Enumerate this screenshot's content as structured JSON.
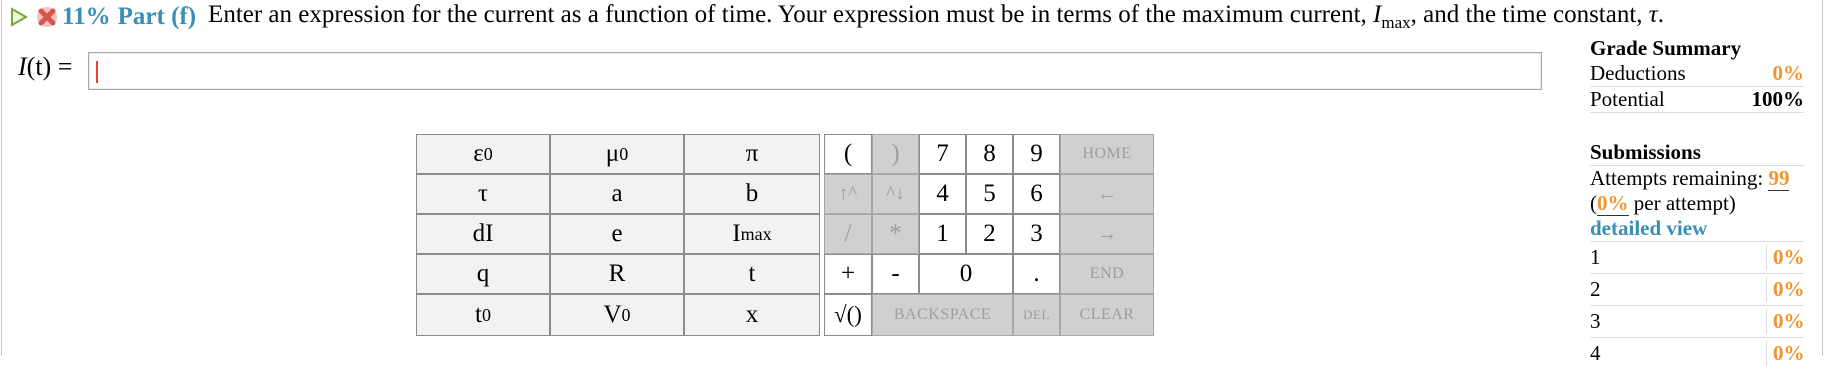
{
  "header": {
    "score_percent": "11%",
    "part_label": "Part (f)",
    "question_text": "Enter an expression for the current as a function of time. Your expression must be in terms of the maximum current, ",
    "var_imax": "I",
    "var_imax_sub": "max",
    "question_mid": ", and the time constant, ",
    "var_tau": "τ",
    "question_end": "."
  },
  "answer": {
    "label_func": "I",
    "label_arg": "(t) =",
    "value": ""
  },
  "keypad": {
    "symbols": [
      {
        "label": "ε",
        "sub": "0"
      },
      {
        "label": "μ",
        "sub": "0"
      },
      {
        "label": "π",
        "sub": ""
      },
      {
        "label": "τ",
        "sub": ""
      },
      {
        "label": "a",
        "sub": ""
      },
      {
        "label": "b",
        "sub": ""
      },
      {
        "label": "dI",
        "sub": ""
      },
      {
        "label": "e",
        "sub": ""
      },
      {
        "label": "I",
        "sub": "max"
      },
      {
        "label": "q",
        "sub": ""
      },
      {
        "label": "R",
        "sub": ""
      },
      {
        "label": "t",
        "sub": ""
      },
      {
        "label": "t",
        "sub": "0"
      },
      {
        "label": "V",
        "sub": "0"
      },
      {
        "label": "x",
        "sub": ""
      }
    ],
    "open_paren": "(",
    "close_paren": ")",
    "up_caret": "↑^",
    "down_caret": "^↓",
    "divide": "/",
    "multiply": "*",
    "plus": "+",
    "minus": "-",
    "sqrt": "√()",
    "digits": [
      "7",
      "8",
      "9",
      "4",
      "5",
      "6",
      "1",
      "2",
      "3",
      "0",
      "."
    ],
    "home": "HOME",
    "left_arrow": "←",
    "right_arrow": "→",
    "end": "END",
    "backspace": "BACKSPACE",
    "del": "DEL",
    "clear": "CLEAR"
  },
  "sidebar": {
    "grade_summary_title": "Grade Summary",
    "deductions_label": "Deductions",
    "deductions_value": "0%",
    "potential_label": "Potential",
    "potential_value": "100%",
    "submissions_title": "Submissions",
    "attempts_label": "Attempts remaining: ",
    "attempts_value": "99",
    "per_attempt_open": "(",
    "per_attempt_value": "0%",
    "per_attempt_text": " per attempt)",
    "detailed_view": "detailed view",
    "submissions": [
      {
        "n": "1",
        "v": "0%"
      },
      {
        "n": "2",
        "v": "0%"
      },
      {
        "n": "3",
        "v": "0%"
      },
      {
        "n": "4",
        "v": "0%"
      }
    ]
  }
}
